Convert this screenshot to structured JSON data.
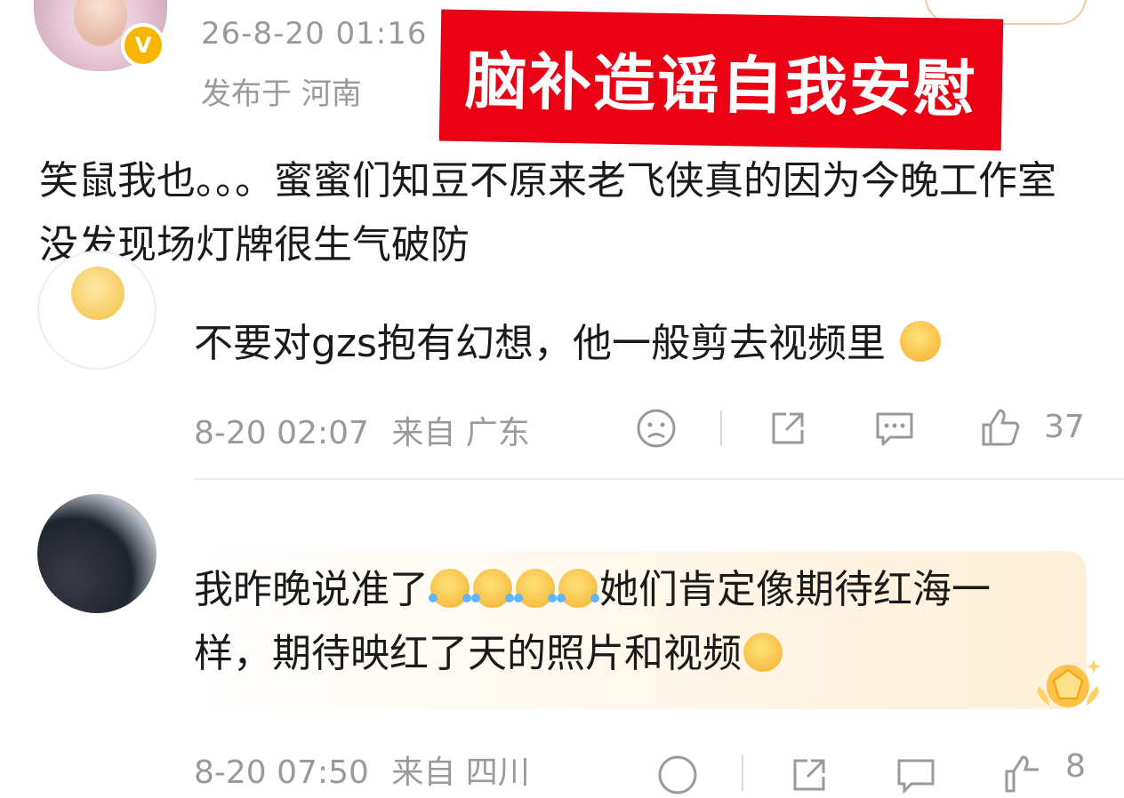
{
  "post": {
    "time": "26-8-20 01:16",
    "location": "发布于 河南",
    "overlay_text": "脑补造谣自我安慰",
    "body": "笑鼠我也。。。蜜蜜们知豆不原来老飞侠真的因为今晚工作室没发现场灯牌很生气破防",
    "vip_badge": "V"
  },
  "comments": [
    {
      "text": "不要对gzs抱有幻想，他一般剪去视频里",
      "emoji": "smile-emoji",
      "time": "8-20 02:07",
      "from": "来自 广东",
      "likes": "37"
    },
    {
      "text_part1": "我昨晚说准了",
      "text_part2": "她们肯定像期待红海一样，期待映红了天的照片和视频",
      "emoji_laugh": "tears-of-joy-emoji",
      "emoji_think": "thinking-emoji",
      "time": "8-20 07:50",
      "from": "来自 四川",
      "likes": "8"
    }
  ],
  "colors": {
    "banner_red": "#eb0014",
    "meta_gray": "#9a9a9a",
    "vip_gold": "#f7b500"
  }
}
